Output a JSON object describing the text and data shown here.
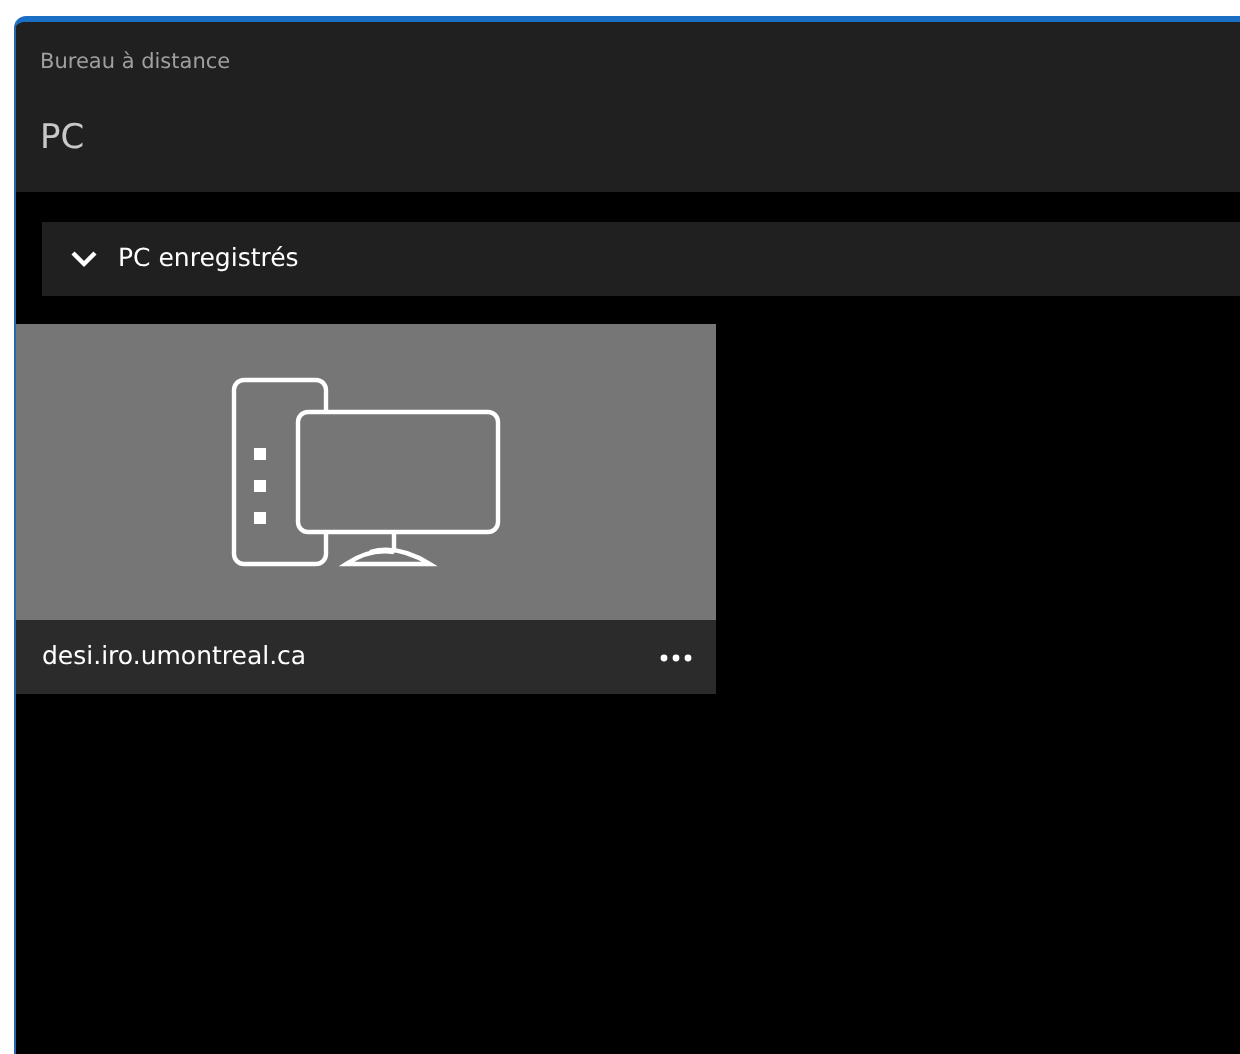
{
  "window": {
    "title": "Bureau à distance"
  },
  "page": {
    "heading": "PC"
  },
  "section": {
    "label": "PC enregistrés",
    "expanded": true
  },
  "pcs": [
    {
      "name": "desi.iro.umontreal.ca"
    }
  ]
}
